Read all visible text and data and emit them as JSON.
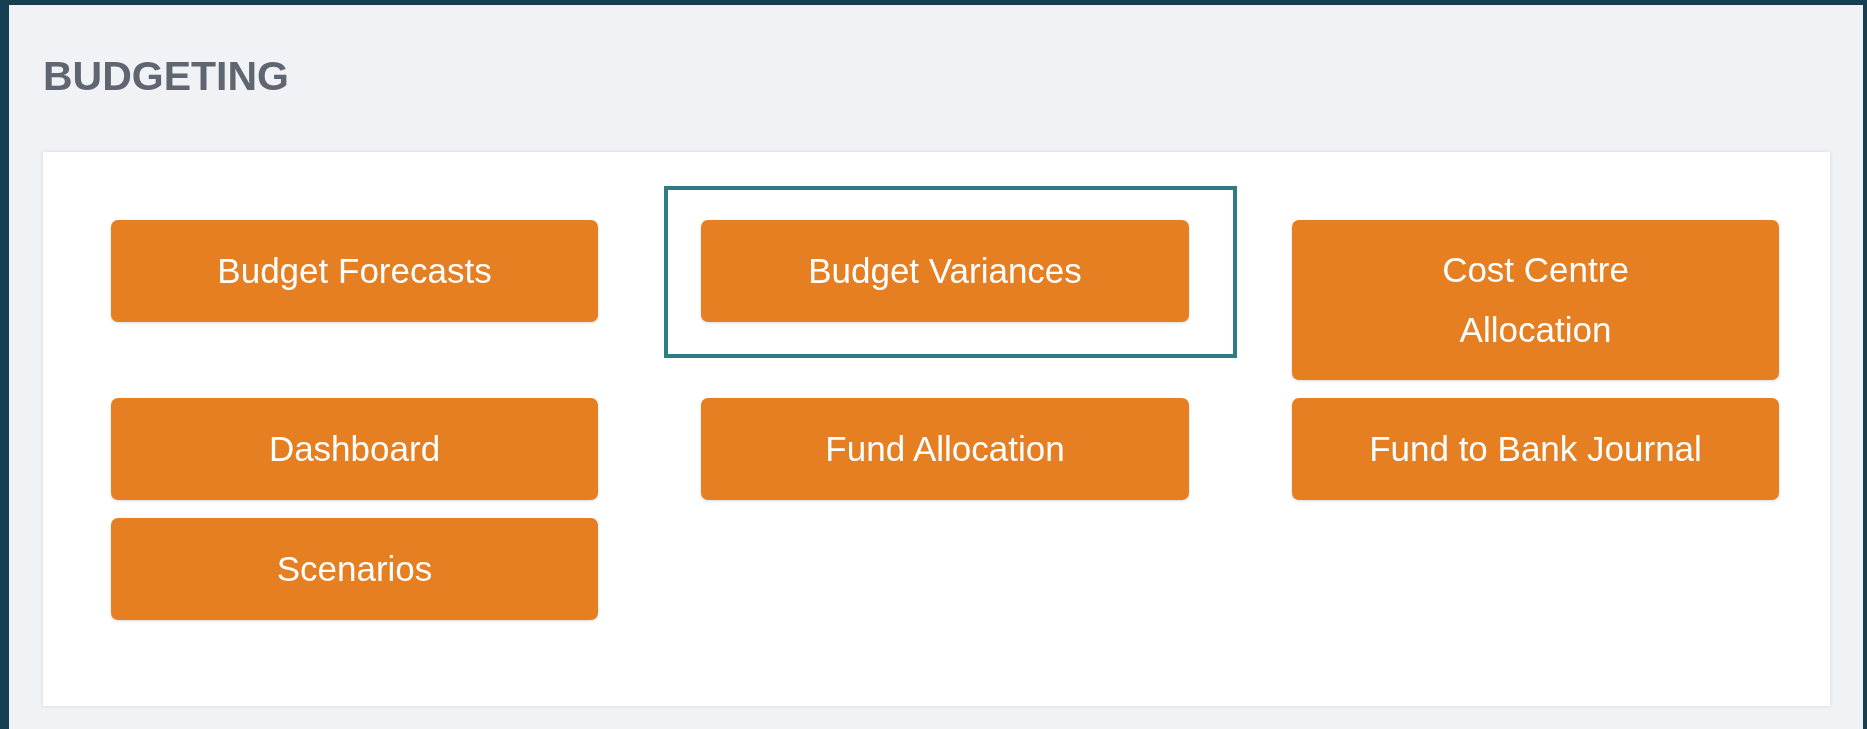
{
  "section": {
    "title": "BUDGETING",
    "buttons": [
      {
        "label": "Budget Forecasts",
        "selected": false
      },
      {
        "label": "Budget Variances",
        "selected": true
      },
      {
        "label": "Cost Centre\nAllocation",
        "selected": false
      },
      {
        "label": "Dashboard",
        "selected": false
      },
      {
        "label": "Fund Allocation",
        "selected": false
      },
      {
        "label": "Fund to Bank Journal",
        "selected": false
      },
      {
        "label": "Scenarios",
        "selected": false
      }
    ]
  }
}
